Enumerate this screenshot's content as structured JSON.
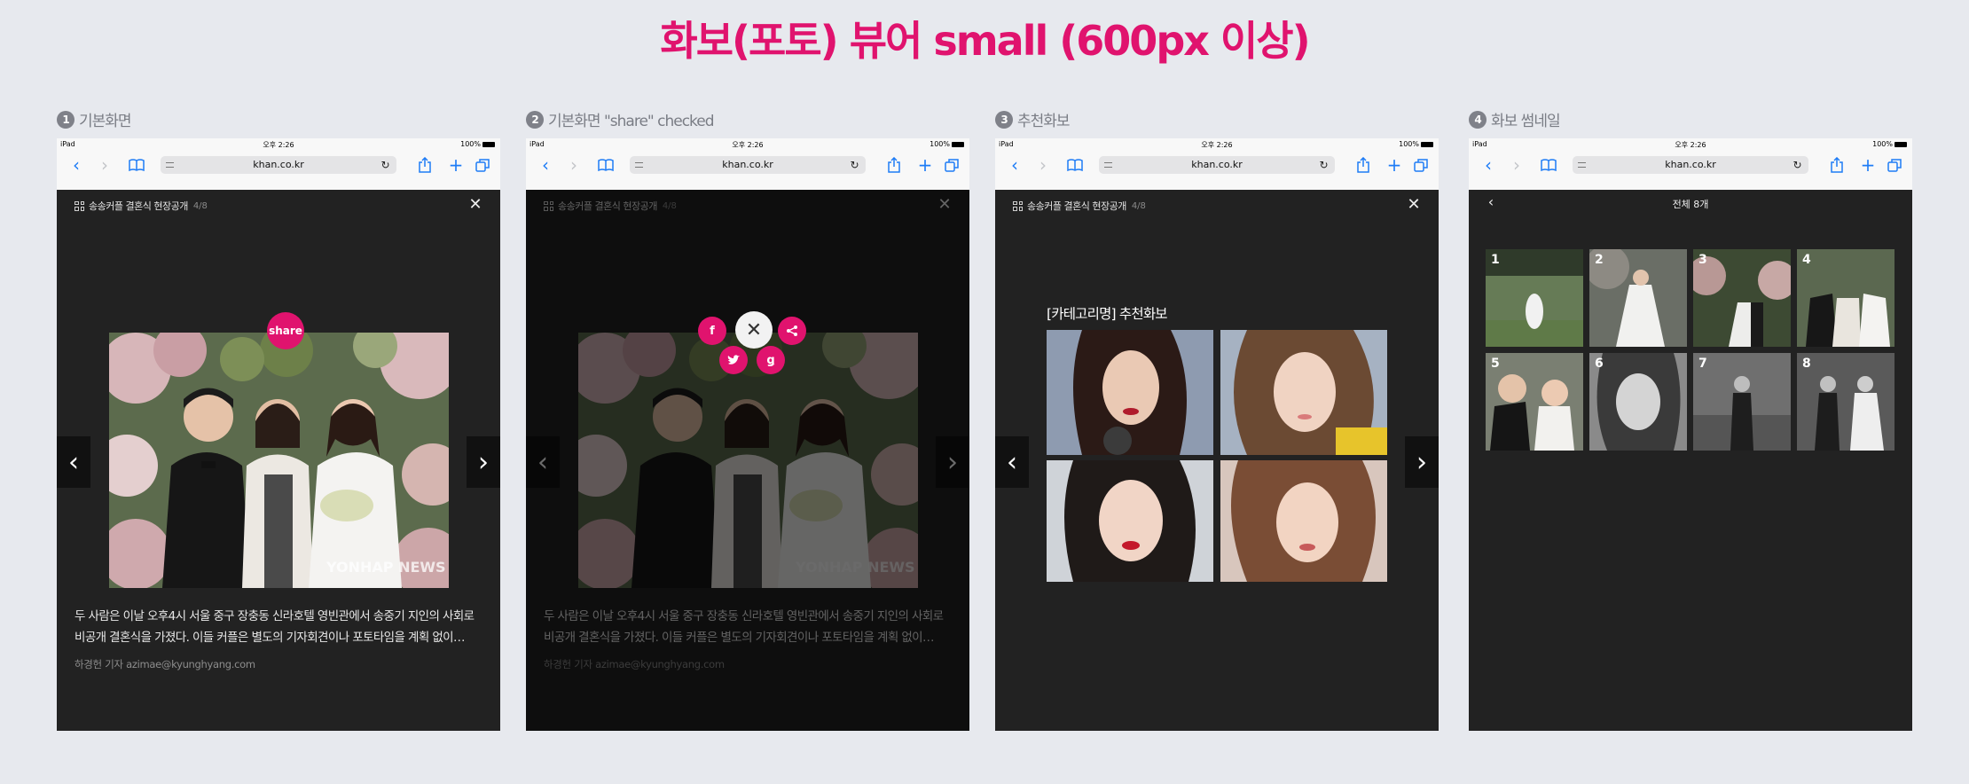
{
  "page_title": "화보(포토) 뷰어 small (600px 이상)",
  "panels": [
    {
      "num": "1",
      "label": "기본화면"
    },
    {
      "num": "2",
      "label": "기본화면 \"share\" checked"
    },
    {
      "num": "3",
      "label": "추천화보"
    },
    {
      "num": "4",
      "label": "화보 썸네일"
    }
  ],
  "browser": {
    "device": "iPad",
    "time": "오후 2:26",
    "battery": "100%",
    "url": "khan.co.kr"
  },
  "viewer": {
    "gallery_title": "송송커플 결혼식 현장공개",
    "counter": "4/8",
    "caption": "두 사람은 이날 오후4시 서울 중구 장충동 신라호텔 영빈관에서 송중기 지인의 사회로 비공개 결혼식을 가졌다. 이들 커플은 별도의 기자회견이나 포토타임을 계획 없이…",
    "byline": "하경헌 기자 azimae@kyunghyang.com",
    "share_label": "share",
    "watermark": "YONHAP NEWS"
  },
  "recommend": {
    "title": "[카테고리명] 추천화보"
  },
  "thumbnails": {
    "title": "전체 8개",
    "items": [
      "1",
      "2",
      "3",
      "4",
      "5",
      "6",
      "7",
      "8"
    ]
  },
  "colors": {
    "accent": "#e0136e",
    "viewer_bg": "#222222",
    "page_bg": "#e7e9ee",
    "safari_blue": "#1e7cf6"
  }
}
